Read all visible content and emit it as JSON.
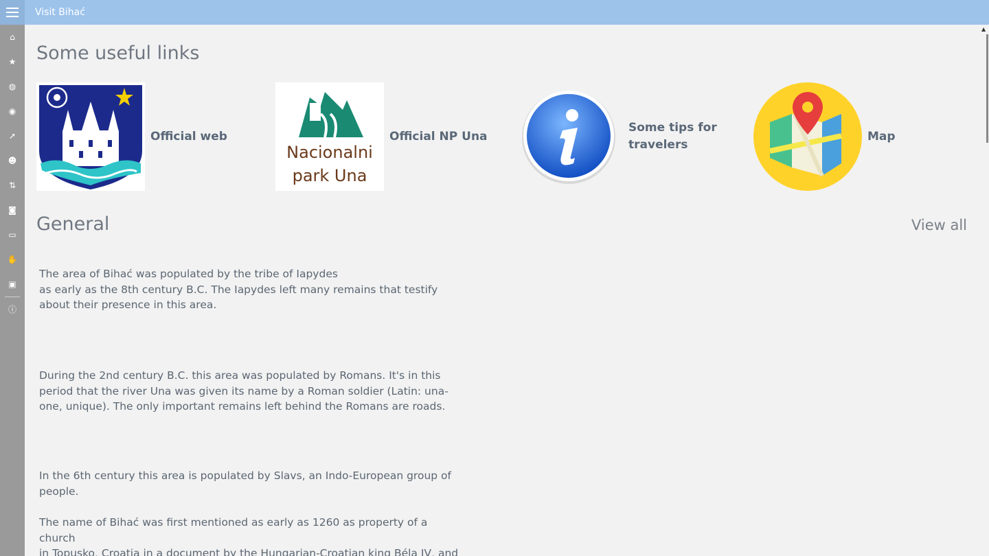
{
  "app": {
    "title": "Visit Bihać"
  },
  "sidebar": {
    "items": [
      {
        "icon": "home-icon",
        "glyph": "⌂"
      },
      {
        "icon": "star-icon",
        "glyph": "★"
      },
      {
        "icon": "globe-icon",
        "glyph": "◍"
      },
      {
        "icon": "eye-icon",
        "glyph": "◉"
      },
      {
        "icon": "arrow-up-right-icon",
        "glyph": "➚"
      },
      {
        "icon": "people-icon",
        "glyph": "☻"
      },
      {
        "icon": "sort-icon",
        "glyph": "⇅"
      },
      {
        "icon": "camera-icon",
        "glyph": "◙"
      },
      {
        "icon": "tablet-icon",
        "glyph": "▭"
      },
      {
        "icon": "thumbs-up-icon",
        "glyph": "✋"
      },
      {
        "icon": "video-camera-icon",
        "glyph": "▣"
      },
      {
        "icon": "info-icon",
        "glyph": "ⓘ"
      }
    ]
  },
  "links": {
    "title": "Some useful links",
    "items": [
      {
        "label_line1": "Official web",
        "label_line2": ""
      },
      {
        "label_line1": "Official NP Una",
        "label_line2": ""
      },
      {
        "label_line1": "Some tips for",
        "label_line2": "travelers"
      },
      {
        "label_line1": "Map",
        "label_line2": ""
      }
    ],
    "np_logo_line1": "Nacionalni",
    "np_logo_line2": "park Una"
  },
  "general": {
    "title": "General",
    "view_all": "View all",
    "paragraphs": [
      "The area of Bihać was populated by the tribe of Iapydes",
      "as early as the 8th century B.C. The Iapydes left many remains that testify",
      "about their presence in this area.",
      "During the 2nd century B.C. this area was populated by Romans. It's in this",
      "period that the river Una was given its name by a Roman soldier (Latin: una-",
      "one, unique). The only important remains left behind the Romans are roads.",
      "In the 6th century this area is populated by Slavs, an Indo-European group of",
      "people.",
      "The name of Bihać was first mentioned as early as 1260 as property of a church",
      "in Topusko, Croatia in a document by the Hungarian-Croatian king Béla IV, and"
    ]
  },
  "colors": {
    "titlebar": "#9dc3eb",
    "sidebar": "#9a9a9a",
    "text": "#5b6672"
  }
}
